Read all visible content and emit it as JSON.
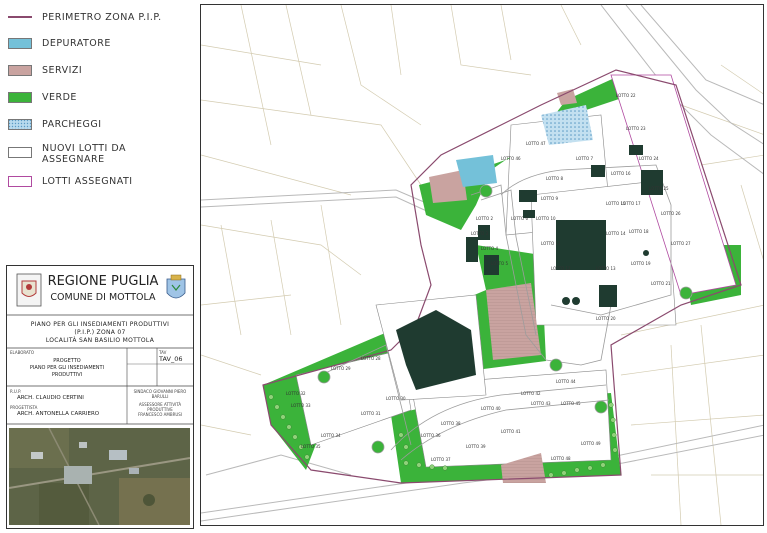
{
  "legend": {
    "items": [
      {
        "label": "PERIMETRO ZONA P.I.P.",
        "kind": "line",
        "color": "#8a4a6e"
      },
      {
        "label": "DEPURATORE",
        "kind": "fill",
        "color": "#74c1d9"
      },
      {
        "label": "SERVIZI",
        "kind": "fill",
        "color": "#c9a3a0"
      },
      {
        "label": "VERDE",
        "kind": "fill",
        "color": "#3bb33a"
      },
      {
        "label": "PARCHEGGI",
        "kind": "hatch",
        "color": "#8fbfdc"
      },
      {
        "label": "NUOVI LOTTI DA",
        "label2": "ASSEGNARE",
        "kind": "fill",
        "color": "#ffffff"
      },
      {
        "label": "LOTTI ASSEGNATI",
        "kind": "line",
        "color": "#b04aa0"
      }
    ]
  },
  "title_block": {
    "region": "REGIONE PUGLIA",
    "comune": "COMUNE DI MOTTOLA",
    "plan_line1": "PIANO PER GLI INSEDIAMENTI PRODUTTIVI",
    "plan_line2": "(P.I.P.) ZONA 07",
    "plan_line3": "LOCALITÀ SAN BASILIO MOTTOLA",
    "elaborato_label": "ELABORATO",
    "project_line1": "PROGETTO",
    "project_line2": "PIANO PER GLI INSEDIAMENTI",
    "project_line3": "PRODUTTIVI",
    "tav_label": "TAV",
    "tav_value": "TAV_06",
    "rup_label": "R.U.P.",
    "rup_name": "ARCH. CLAUDIO CERTINI",
    "progettista_label": "PROGETTISTA",
    "progettista_name": "ARCH. ANTONELLA CARRIERO",
    "sindaco_label": "SINDACO GIOVANNI PIERO BARULLI",
    "assessore_line1": "ASSESSORE ATTIVITÀ",
    "assessore_line2": "PRODUTTIVE",
    "assessore_line3": "FRANCESCO AMBRUSI"
  },
  "map": {
    "lots": [
      {
        "label": "LOTTO 22"
      },
      {
        "label": "LOTTO 23"
      },
      {
        "label": "LOTTO 24"
      },
      {
        "label": "LOTTO 25"
      },
      {
        "label": "LOTTO 26"
      },
      {
        "label": "LOTTO 27"
      },
      {
        "label": "LOTTO 21"
      },
      {
        "label": "LOTTO 20"
      },
      {
        "label": "LOTTO 19"
      },
      {
        "label": "LOTTO 18"
      },
      {
        "label": "LOTTO 17"
      },
      {
        "label": "LOTTO 16"
      },
      {
        "label": "LOTTO 15"
      },
      {
        "label": "LOTTO 14"
      },
      {
        "label": "LOTTO 13"
      },
      {
        "label": "LOTTO 12"
      },
      {
        "label": "LOTTO 11"
      },
      {
        "label": "LOTTO 10"
      },
      {
        "label": "LOTTO 9"
      },
      {
        "label": "LOTTO 8"
      },
      {
        "label": "LOTTO 7"
      },
      {
        "label": "LOTTO 6"
      },
      {
        "label": "LOTTO 5"
      },
      {
        "label": "LOTTO 4"
      },
      {
        "label": "LOTTO 3"
      },
      {
        "label": "LOTTO 2"
      },
      {
        "label": "LOTTO 47"
      },
      {
        "label": "LOTTO 46"
      },
      {
        "label": "LOTTO 28"
      },
      {
        "label": "LOTTO 29"
      },
      {
        "label": "LOTTO 30"
      },
      {
        "label": "LOTTO 31"
      },
      {
        "label": "LOTTO 32"
      },
      {
        "label": "LOTTO 33"
      },
      {
        "label": "LOTTO 34"
      },
      {
        "label": "LOTTO 35"
      },
      {
        "label": "LOTTO 36"
      },
      {
        "label": "LOTTO 37"
      },
      {
        "label": "LOTTO 38"
      },
      {
        "label": "LOTTO 39"
      },
      {
        "label": "LOTTO 40"
      },
      {
        "label": "LOTTO 41"
      },
      {
        "label": "LOTTO 42"
      },
      {
        "label": "LOTTO 43"
      },
      {
        "label": "LOTTO 44"
      },
      {
        "label": "LOTTO 45"
      },
      {
        "label": "LOTTO 48"
      },
      {
        "label": "LOTTO 49"
      }
    ]
  }
}
